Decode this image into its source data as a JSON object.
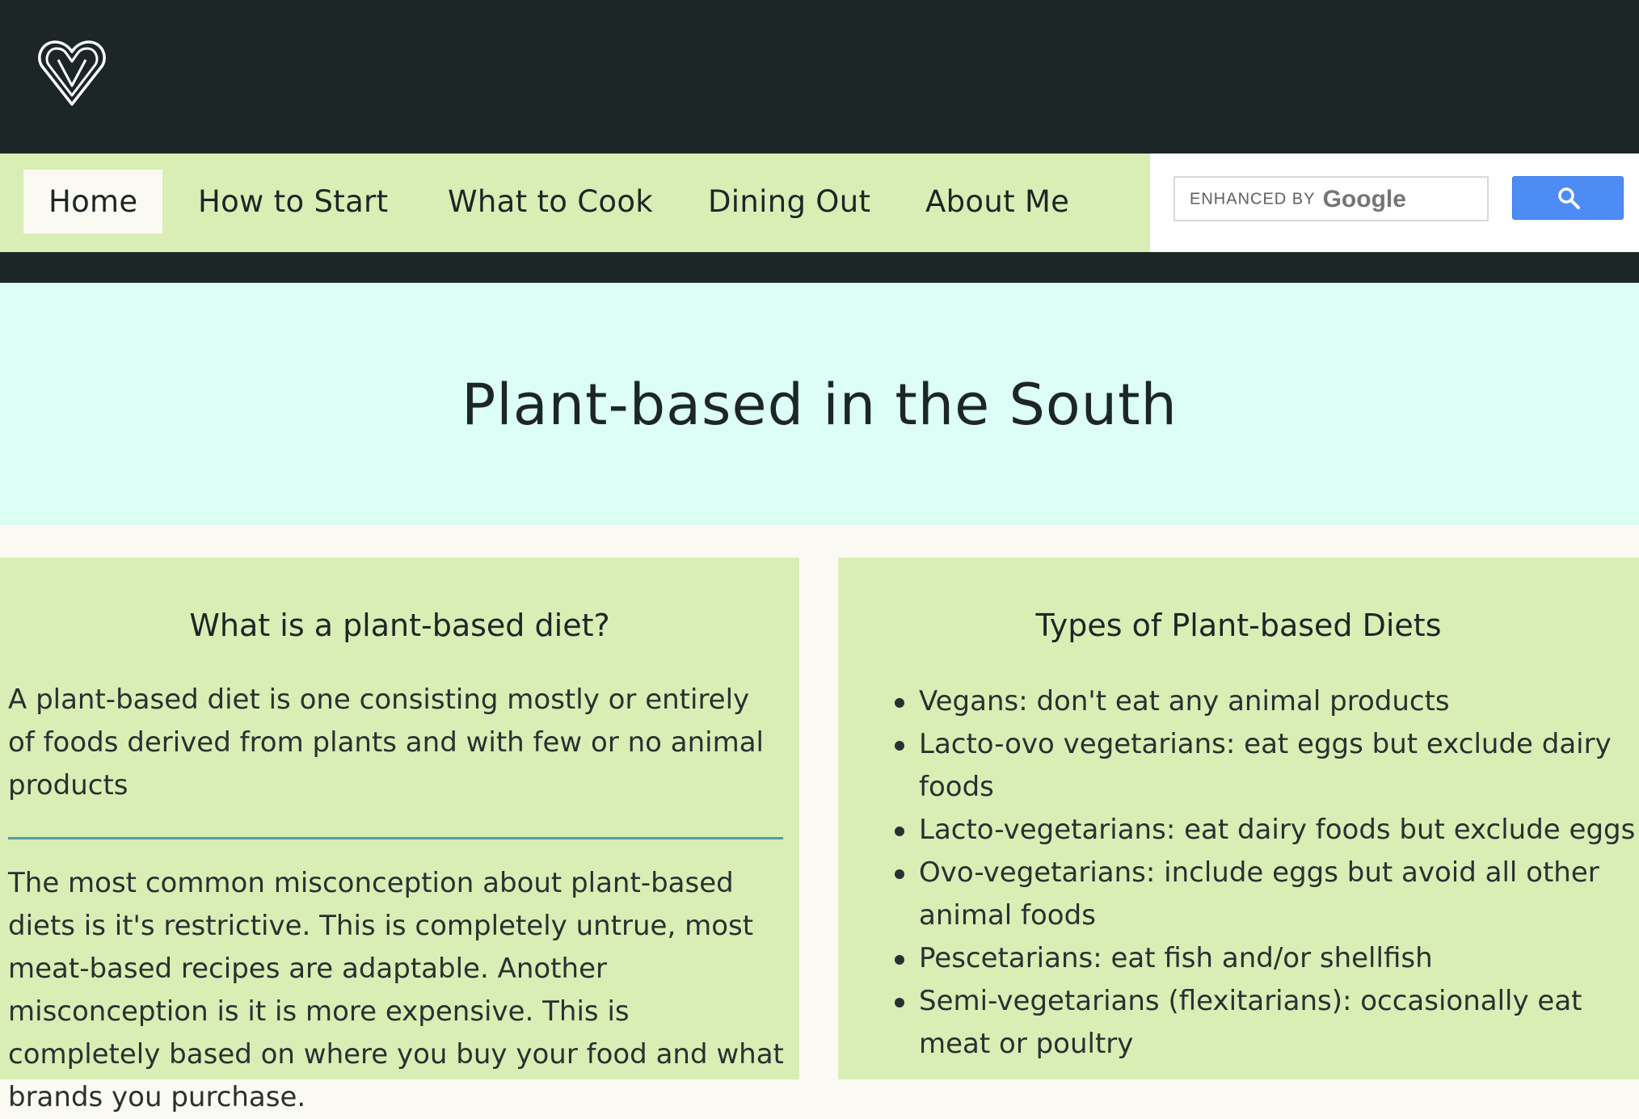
{
  "nav": {
    "items": [
      {
        "label": "Home",
        "active": true
      },
      {
        "label": "How to Start",
        "active": false
      },
      {
        "label": "What to Cook",
        "active": false
      },
      {
        "label": "Dining Out",
        "active": false
      },
      {
        "label": "About Me",
        "active": false
      }
    ]
  },
  "search": {
    "watermark_prefix": "ENHANCED BY",
    "watermark_brand": "Google",
    "button_icon": "search-icon"
  },
  "logo": {
    "icon": "heart-v-logo"
  },
  "hero": {
    "title": "Plant-based in the South"
  },
  "left_panel": {
    "heading": "What is a plant-based diet?",
    "paragraph_1": "A plant-based diet is one consisting mostly or entirely of foods derived from plants and with few or no animal products",
    "paragraph_2": "The most common misconception about plant-based diets is it's restrictive. This is completely untrue, most meat-based recipes are adaptable. Another misconception is it is more expensive. This is completely based on where you buy your food and what brands you purchase."
  },
  "right_panel": {
    "heading": "Types of Plant-based Diets",
    "items": [
      "Vegans: don't eat any animal products",
      "Lacto-ovo vegetarians: eat eggs but exclude dairy foods",
      "Lacto-vegetarians: eat dairy foods but exclude eggs",
      "Ovo-vegetarians: include eggs but avoid all other animal foods",
      "Pescetarians: eat fish and/or shellfish",
      "Semi-vegetarians (flexitarians): occasionally eat meat or poultry"
    ]
  },
  "colors": {
    "dark": "#1d2626",
    "nav_bg": "#d9eeb5",
    "hero_bg": "#dcfef4",
    "page_bg": "#fbfaf2",
    "divider": "#4e9aa8",
    "search_button": "#4d8cf5"
  }
}
